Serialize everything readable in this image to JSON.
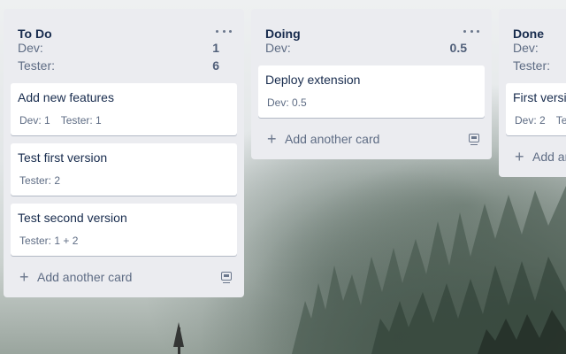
{
  "lists": [
    {
      "title": "To Do",
      "stats": [
        {
          "label": "Dev:",
          "value": "1"
        },
        {
          "label": "Tester:",
          "value": "6"
        }
      ],
      "cards": [
        {
          "title": "Add new features",
          "badges": [
            "Dev: 1",
            "Tester: 1"
          ]
        },
        {
          "title": "Test first version",
          "badges": [
            "Tester: 2"
          ]
        },
        {
          "title": "Test second version",
          "badges": [
            "Tester: 1 + 2"
          ]
        }
      ],
      "add_card_label": "Add another card"
    },
    {
      "title": "Doing",
      "stats": [
        {
          "label": "Dev:",
          "value": "0.5"
        }
      ],
      "cards": [
        {
          "title": "Deploy extension",
          "badges": [
            "Dev: 0.5"
          ]
        }
      ],
      "add_card_label": "Add another card"
    },
    {
      "title": "Done",
      "stats": [
        {
          "label": "Dev:",
          "value": ""
        },
        {
          "label": "Tester:",
          "value": ""
        }
      ],
      "cards": [
        {
          "title": "First versi",
          "badges": [
            "Dev: 2",
            "Te"
          ]
        }
      ],
      "add_card_label": "Add an"
    }
  ],
  "icons": {
    "list_menu": "more-horizontal-icon",
    "add": "plus-icon",
    "template": "card-template-icon"
  }
}
